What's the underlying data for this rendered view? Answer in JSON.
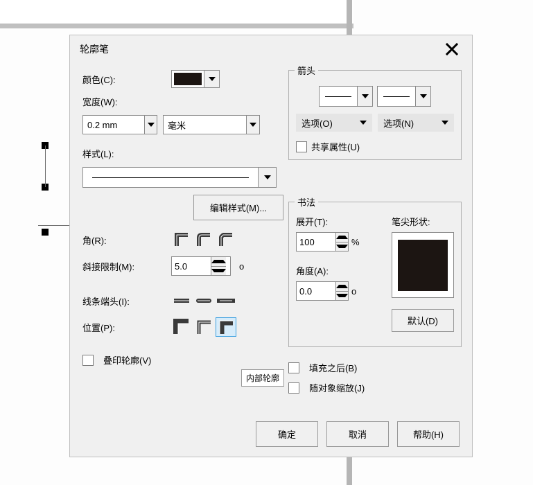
{
  "dialog": {
    "title": "轮廓笔",
    "labels": {
      "color": "颜色(C):",
      "width": "宽度(W):",
      "style": "样式(L):",
      "edit_style": "编辑样式(M)...",
      "corner": "角(R):",
      "miter_limit": "斜接限制(M):",
      "line_caps": "线条端头(I):",
      "position": "位置(P):",
      "overprint": "叠印轮廓(V)",
      "fill_after": "填充之后(B)",
      "scale_with": "随对象缩放(J)"
    },
    "values": {
      "width": "0.2 mm",
      "unit": "毫米",
      "miter_limit": "5.0"
    },
    "arrowhead": {
      "legend": "箭头",
      "options_left": "选项(O)",
      "options_right": "选项(N)",
      "share": "共享属性(U)"
    },
    "calligraphy": {
      "legend": "书法",
      "stretch_label": "展开(T):",
      "stretch_value": "100",
      "stretch_pct": "%",
      "angle_label": "角度(A):",
      "angle_value": "0.0",
      "angle_deg": "o",
      "nib_label": "笔尖形状:",
      "default_btn": "默认(D)"
    },
    "tooltip": "内部轮廓",
    "buttons": {
      "ok": "确定",
      "cancel": "取消",
      "help": "帮助(H)"
    },
    "deg_symbol": "o"
  }
}
